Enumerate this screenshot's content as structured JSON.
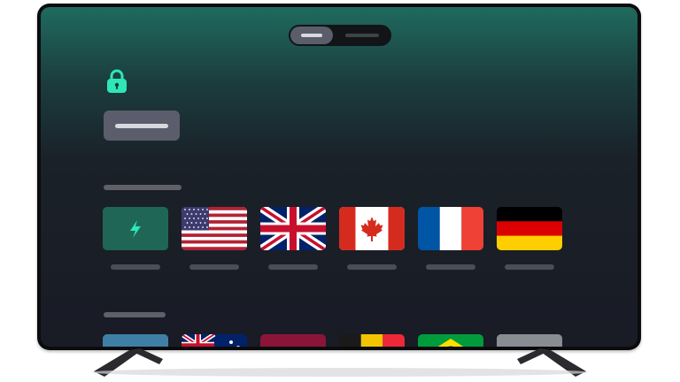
{
  "app": {
    "accent_color": "#2ee6b8",
    "background_color": "#191b25"
  },
  "mode_toggle": {
    "options": [
      "mode-a",
      "mode-b"
    ],
    "selected_index": 0
  },
  "lock": {
    "icon": "lock-icon",
    "color": "#2ee6b8"
  },
  "connect_button": {
    "label": ""
  },
  "sections": [
    {
      "label": "",
      "items": [
        {
          "id": "fastest",
          "icon": "lightning-bolt-icon",
          "label": ""
        },
        {
          "id": "us",
          "icon": "flag-united-states-icon",
          "label": ""
        },
        {
          "id": "uk",
          "icon": "flag-united-kingdom-icon",
          "label": ""
        },
        {
          "id": "ca",
          "icon": "flag-canada-icon",
          "label": ""
        },
        {
          "id": "fr",
          "icon": "flag-france-icon",
          "label": ""
        },
        {
          "id": "de",
          "icon": "flag-germany-icon",
          "label": ""
        }
      ]
    },
    {
      "label": "",
      "items": [
        {
          "id": "item-7",
          "icon": "flag-placeholder-icon",
          "label": ""
        },
        {
          "id": "au",
          "icon": "flag-australia-icon",
          "label": ""
        },
        {
          "id": "item-9",
          "icon": "flag-placeholder-icon",
          "label": ""
        },
        {
          "id": "be",
          "icon": "flag-belgium-icon",
          "label": ""
        },
        {
          "id": "br",
          "icon": "flag-brazil-icon",
          "label": ""
        },
        {
          "id": "item-12",
          "icon": "flag-placeholder-icon",
          "label": ""
        }
      ]
    }
  ]
}
